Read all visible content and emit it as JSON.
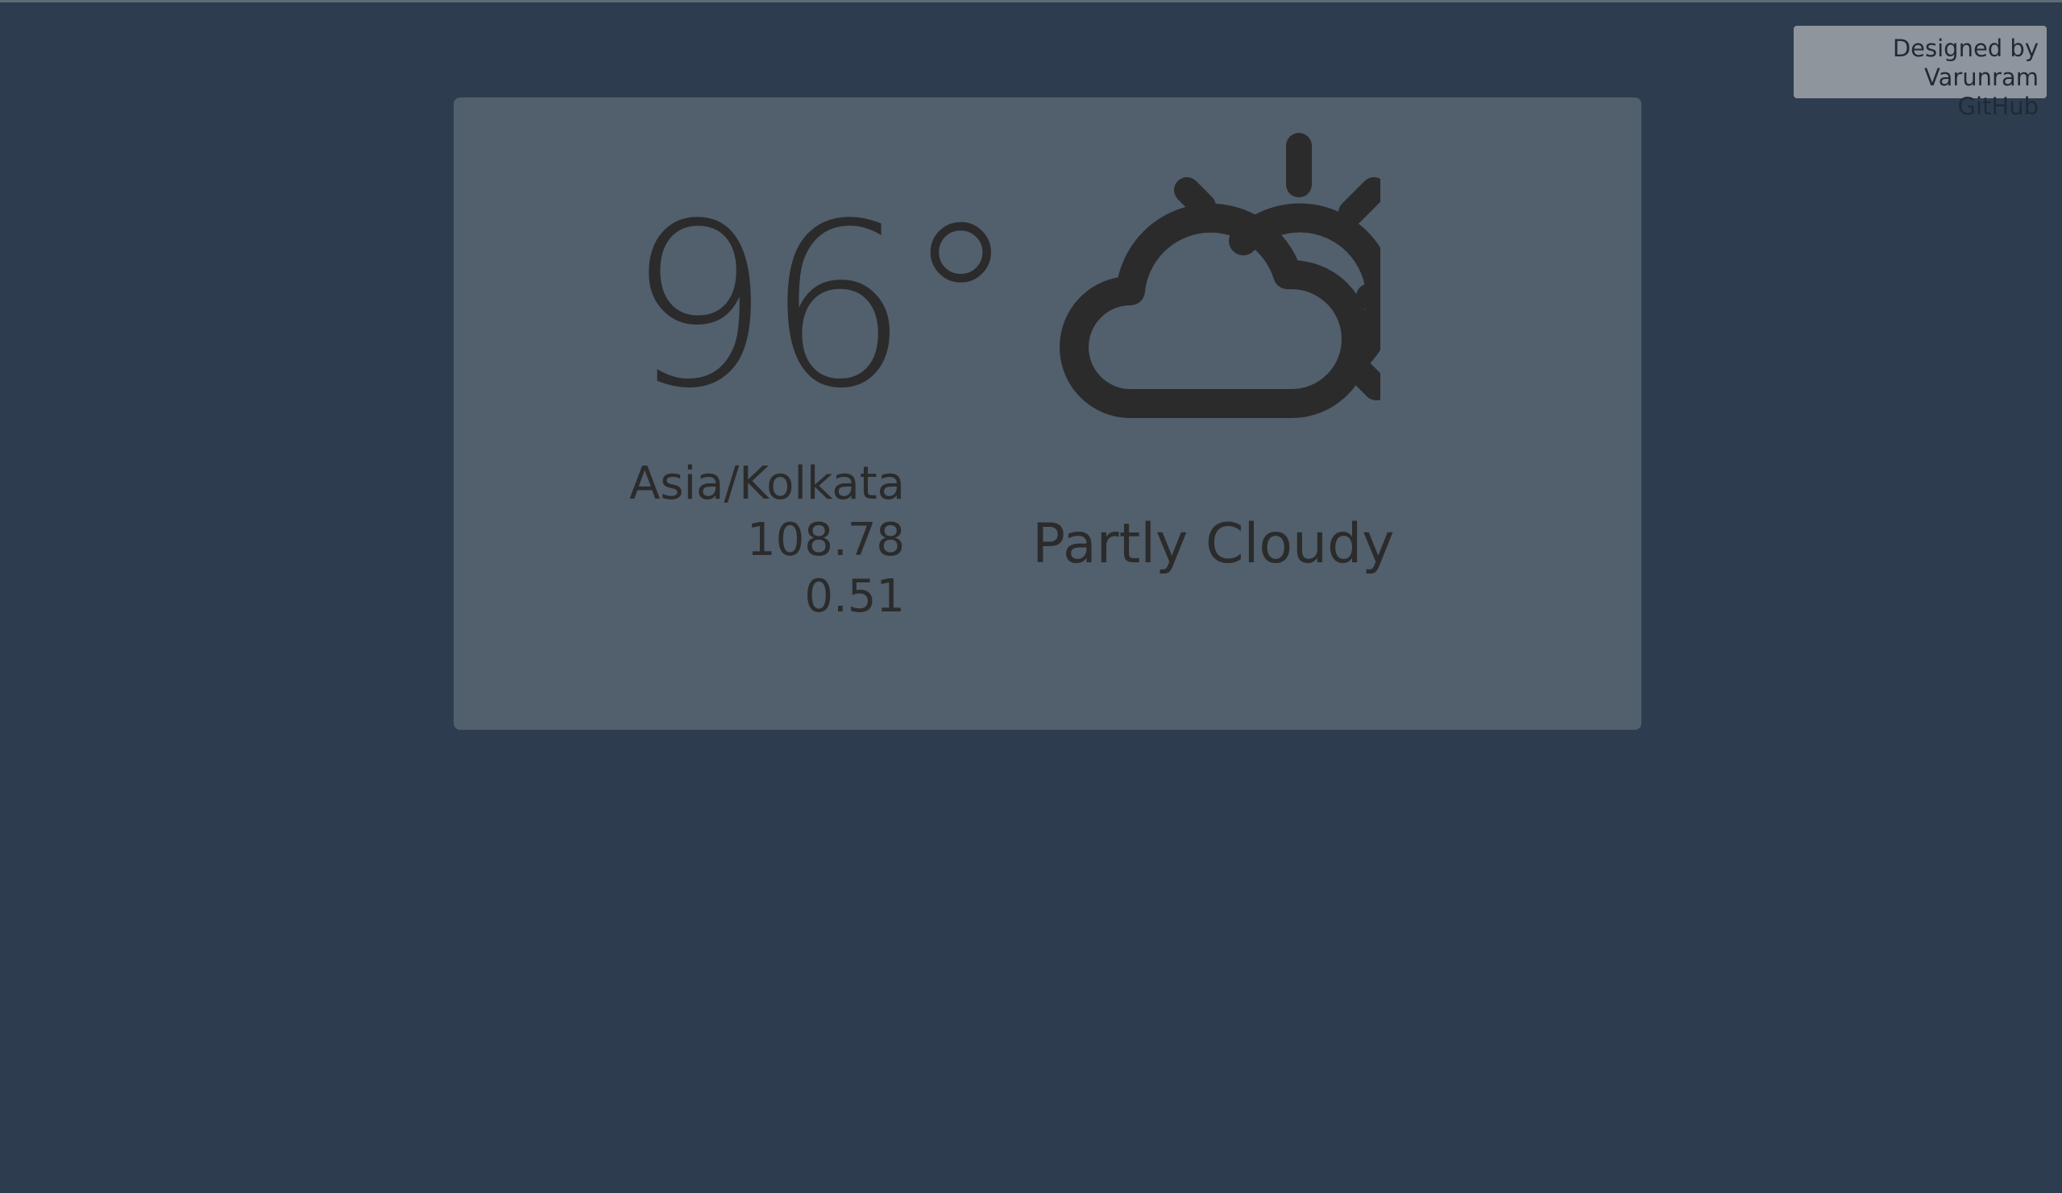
{
  "credit": {
    "designed_by": "Designed by Varunram",
    "github_label": "GitHub"
  },
  "weather": {
    "temperature": "96°",
    "timezone": "Asia/Kolkata",
    "longitude": "108.78",
    "latitude": "0.51",
    "summary": "Partly Cloudy",
    "icon": "partly-cloudy-day-icon"
  },
  "colors": {
    "background": "#2d3d4f",
    "card": "#525f6d",
    "text": "#2b2b2b",
    "credit_box": "#8e959c"
  }
}
